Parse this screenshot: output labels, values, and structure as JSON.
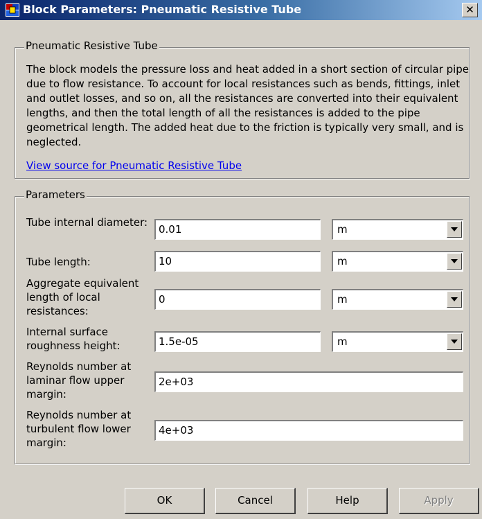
{
  "window": {
    "title": "Block Parameters: Pneumatic Resistive Tube",
    "close_label": "✕"
  },
  "description_group": {
    "legend": "Pneumatic Resistive Tube",
    "text": "The block models the pressure loss and heat added in a short section of circular pipe due to flow resistance. To account for local resistances such as bends, fittings, inlet and outlet losses, and so on, all the resistances are converted into their equivalent lengths, and then the total length of all the resistances is added to the pipe geometrical length. The added heat due to the friction is typically very small, and is neglected.",
    "link": "View source for Pneumatic Resistive Tube"
  },
  "parameters_group": {
    "legend": "Parameters",
    "params": [
      {
        "label": "Tube internal diameter:",
        "value": "0.01",
        "unit": "m"
      },
      {
        "label": "Tube length:",
        "value": "10",
        "unit": "m"
      },
      {
        "label": "Aggregate equivalent length of local resistances:",
        "value": "0",
        "unit": "m"
      },
      {
        "label": "Internal surface roughness height:",
        "value": "1.5e-05",
        "unit": "m"
      },
      {
        "label": "Reynolds number at laminar flow upper margin:",
        "value": "2e+03"
      },
      {
        "label": "Reynolds number at turbulent flow lower margin:",
        "value": "4e+03"
      }
    ]
  },
  "buttons": {
    "ok": "OK",
    "cancel": "Cancel",
    "help": "Help",
    "apply": "Apply"
  },
  "icons": {
    "window_icon": "simulink-block-icon",
    "close": "close-icon",
    "dropdown": "chevron-down-icon"
  }
}
